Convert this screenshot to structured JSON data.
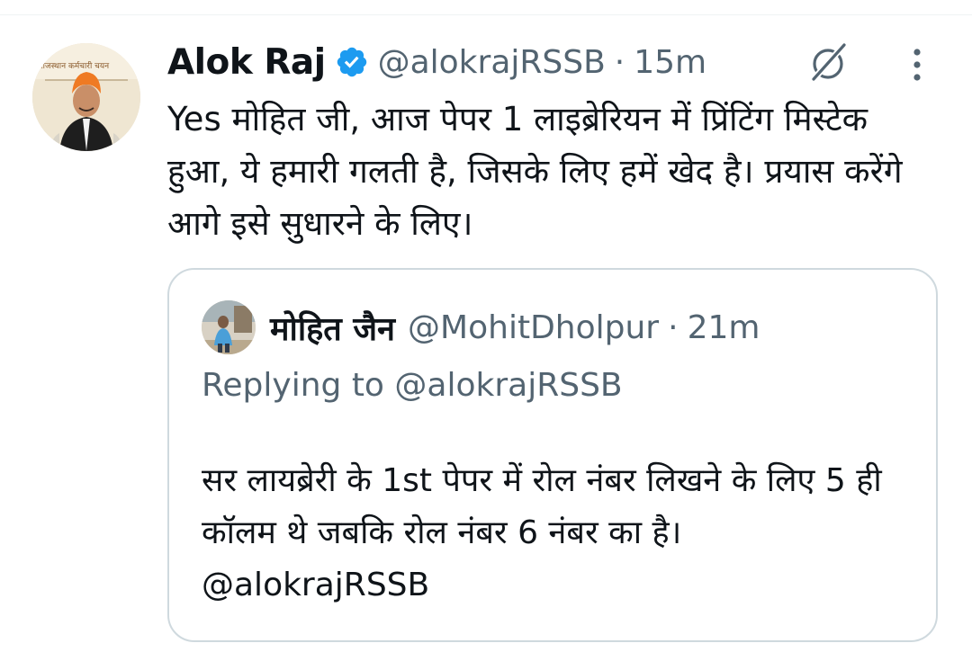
{
  "tweet": {
    "author_name": "Alok Raj",
    "handle": "@alokrajRSSB",
    "separator": "·",
    "time": "15m",
    "text": "Yes मोहित जी, आज पेपर 1 लाइब्रेरियन में प्रिंटिंग मिस्टेक हुआ, ये हमारी गलती है, जिसके लिए हमें खेद है। प्रयास करेंगे आगे इसे सुधारने के लिए।",
    "avatar_banner_text": "राजस्थान कर्मचारी चयन"
  },
  "quoted_tweet": {
    "author_name": "मोहित जैन",
    "handle": "@MohitDholpur",
    "separator": "·",
    "time": "21m",
    "replying_to": "Replying to @alokrajRSSB",
    "text": "सर लायब्रेरी के 1st पेपर में रोल नंबर लिखने के लिए 5 ही कॉलम थे जबकि रोल नंबर 6 नंबर का है। @alokrajRSSB"
  },
  "icons": {
    "verified": "verified-badge-icon",
    "grok": "grok-icon",
    "more": "more-vertical-icon"
  },
  "colors": {
    "verified_blue": "#1d9bf0",
    "secondary_text": "#536471",
    "primary_text": "#0f1419",
    "border": "#cfd9de"
  }
}
